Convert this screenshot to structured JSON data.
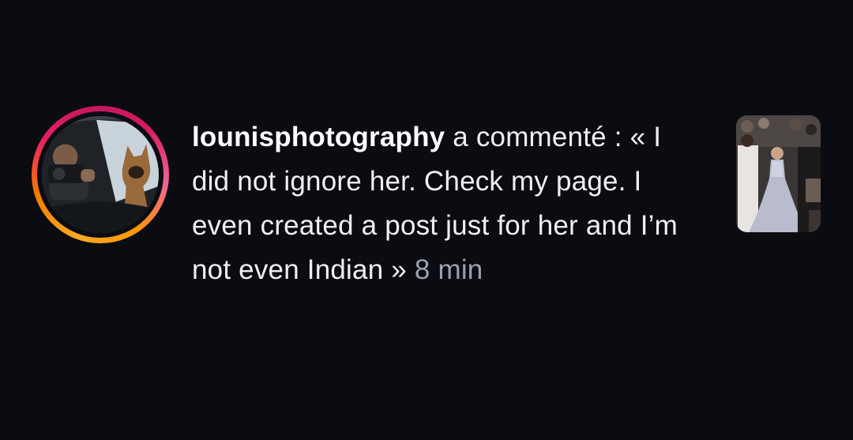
{
  "notification": {
    "username": "lounisphotography",
    "action": " a commenté : ",
    "comment": "« I did not ignore her. Check my page. I even created a post just for her and I’m not even Indian »",
    "time": "8 min"
  },
  "icons": {
    "avatar": "profile-photo-avatar",
    "thumbnail": "post-thumbnail-image"
  },
  "colors": {
    "background": "#0b0c12",
    "text": "#eef0f4",
    "timestamp": "#9ba1ad",
    "ring_start": "#f9a825",
    "ring_end": "#e91e63"
  }
}
